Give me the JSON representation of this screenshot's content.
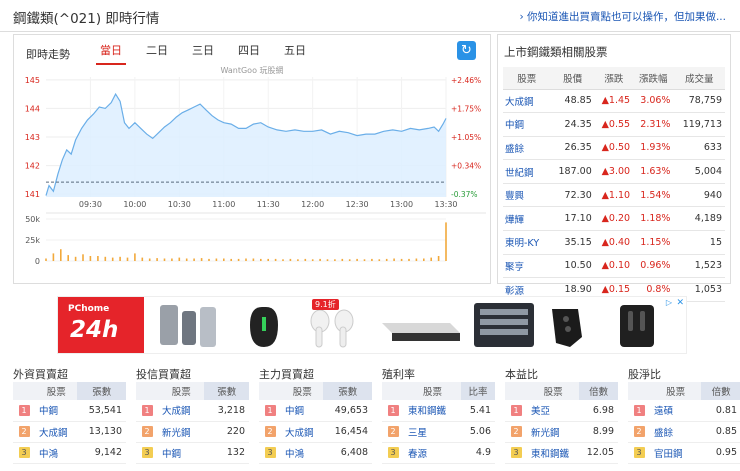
{
  "header": {
    "title": "鋼鐵類(^021) 即時行情",
    "hint_link": "› 你知道進出買賣點也可以操作，但加果做..."
  },
  "chart_panel": {
    "label": "即時走勢",
    "tabs": [
      "當日",
      "二日",
      "三日",
      "四日",
      "五日"
    ],
    "active_tab": 0,
    "watermark": "WantGoo 玩股網",
    "refresh_icon": "refresh-icon"
  },
  "chart_data": {
    "type": "area",
    "price_axis": {
      "ticks": [
        145,
        144,
        143,
        142,
        141
      ],
      "ylim": [
        140.9,
        145.1
      ],
      "pct_ticks": [
        "+2.46%",
        "+1.75%",
        "+1.05%",
        "+0.34%",
        "-0.37%"
      ],
      "reference": 141.42
    },
    "time_axis": {
      "ticks": [
        "09:30",
        "10:00",
        "10:30",
        "11:00",
        "11:30",
        "12:00",
        "12:30",
        "13:00",
        "13:30"
      ],
      "start": "09:00",
      "end": "13:30"
    },
    "price_series": [
      [
        "09:00",
        140.95
      ],
      [
        "09:02",
        141.3
      ],
      [
        "09:05",
        141.1
      ],
      [
        "09:08",
        141.7
      ],
      [
        "09:11",
        142.2
      ],
      [
        "09:14",
        142.55
      ],
      [
        "09:17",
        142.4
      ],
      [
        "09:20",
        142.9
      ],
      [
        "09:24",
        143.3
      ],
      [
        "09:28",
        143.6
      ],
      [
        "09:32",
        143.8
      ],
      [
        "09:36",
        144.05
      ],
      [
        "09:40",
        144.0
      ],
      [
        "09:44",
        144.2
      ],
      [
        "09:47",
        144.5
      ],
      [
        "09:50",
        144.25
      ],
      [
        "09:53",
        143.5
      ],
      [
        "09:56",
        143.3
      ],
      [
        "10:00",
        143.5
      ],
      [
        "10:04",
        143.3
      ],
      [
        "10:08",
        143.1
      ],
      [
        "10:12",
        142.95
      ],
      [
        "10:16",
        143.15
      ],
      [
        "10:20",
        143.35
      ],
      [
        "10:24",
        143.5
      ],
      [
        "10:28",
        143.7
      ],
      [
        "10:32",
        143.85
      ],
      [
        "10:36",
        143.95
      ],
      [
        "10:40",
        144.05
      ],
      [
        "10:44",
        144.15
      ],
      [
        "10:48",
        143.95
      ],
      [
        "10:52",
        143.75
      ],
      [
        "10:56",
        143.6
      ],
      [
        "11:00",
        143.5
      ],
      [
        "11:05",
        143.45
      ],
      [
        "11:10",
        143.3
      ],
      [
        "11:15",
        143.3
      ],
      [
        "11:20",
        143.45
      ],
      [
        "11:25",
        143.5
      ],
      [
        "11:30",
        143.35
      ],
      [
        "11:36",
        143.25
      ],
      [
        "11:42",
        143.2
      ],
      [
        "11:48",
        143.25
      ],
      [
        "11:54",
        143.2
      ],
      [
        "12:00",
        143.2
      ],
      [
        "12:06",
        143.25
      ],
      [
        "12:12",
        143.1
      ],
      [
        "12:18",
        143.2
      ],
      [
        "12:24",
        143.15
      ],
      [
        "12:30",
        143.05
      ],
      [
        "12:36",
        143.1
      ],
      [
        "12:42",
        143.1
      ],
      [
        "12:48",
        143.2
      ],
      [
        "12:54",
        143.25
      ],
      [
        "13:00",
        143.2
      ],
      [
        "13:06",
        143.3
      ],
      [
        "13:12",
        143.25
      ],
      [
        "13:18",
        143.3
      ],
      [
        "13:22",
        143.35
      ],
      [
        "13:25",
        143.2
      ],
      [
        "13:28",
        143.45
      ],
      [
        "13:30",
        143.65
      ]
    ],
    "volume_axis": {
      "ticks": [
        "50k",
        "25k",
        "0"
      ],
      "ylim": [
        0,
        50000
      ]
    },
    "volume_series": [
      [
        "09:00",
        3000
      ],
      [
        "09:05",
        9000
      ],
      [
        "09:10",
        14000
      ],
      [
        "09:15",
        7000
      ],
      [
        "09:20",
        5000
      ],
      [
        "09:25",
        8000
      ],
      [
        "09:30",
        6000
      ],
      [
        "09:35",
        6000
      ],
      [
        "09:40",
        5000
      ],
      [
        "09:45",
        4000
      ],
      [
        "09:50",
        5000
      ],
      [
        "09:55",
        4000
      ],
      [
        "10:00",
        9000
      ],
      [
        "10:05",
        4000
      ],
      [
        "10:10",
        3000
      ],
      [
        "10:15",
        3500
      ],
      [
        "10:20",
        3000
      ],
      [
        "10:25",
        3000
      ],
      [
        "10:30",
        4000
      ],
      [
        "10:35",
        3000
      ],
      [
        "10:40",
        3000
      ],
      [
        "10:45",
        3500
      ],
      [
        "10:50",
        2500
      ],
      [
        "10:55",
        3000
      ],
      [
        "11:00",
        3000
      ],
      [
        "11:05",
        2500
      ],
      [
        "11:10",
        2500
      ],
      [
        "11:15",
        3000
      ],
      [
        "11:20",
        3000
      ],
      [
        "11:25",
        2500
      ],
      [
        "11:30",
        2500
      ],
      [
        "11:35",
        2500
      ],
      [
        "11:40",
        2000
      ],
      [
        "11:45",
        2500
      ],
      [
        "11:50",
        2000
      ],
      [
        "11:55",
        2500
      ],
      [
        "12:00",
        2000
      ],
      [
        "12:05",
        2500
      ],
      [
        "12:10",
        2000
      ],
      [
        "12:15",
        2000
      ],
      [
        "12:20",
        2500
      ],
      [
        "12:25",
        2000
      ],
      [
        "12:30",
        2500
      ],
      [
        "12:35",
        2000
      ],
      [
        "12:40",
        2500
      ],
      [
        "12:45",
        2000
      ],
      [
        "12:50",
        2500
      ],
      [
        "12:55",
        3000
      ],
      [
        "13:00",
        2500
      ],
      [
        "13:05",
        2500
      ],
      [
        "13:10",
        3000
      ],
      [
        "13:15",
        3000
      ],
      [
        "13:20",
        4000
      ],
      [
        "13:25",
        6000
      ],
      [
        "13:30",
        46000
      ]
    ],
    "colors": {
      "line": "#6aaee8",
      "fill": "#ddeeff",
      "volume": "#f2a93b",
      "pct_up": "#d8261d",
      "pct_down": "#2a9d3a",
      "reference": "#5a6b7e"
    }
  },
  "related": {
    "title": "上市鋼鐵類相關股票",
    "columns": [
      "股票",
      "股價",
      "漲跌",
      "漲跌幅",
      "成交量"
    ],
    "rows": [
      [
        "大成鋼",
        "48.85",
        "▲1.45",
        "3.06%",
        "78,759"
      ],
      [
        "中鋼",
        "24.35",
        "▲0.55",
        "2.31%",
        "119,713"
      ],
      [
        "盛餘",
        "26.35",
        "▲0.50",
        "1.93%",
        "633"
      ],
      [
        "世紀鋼",
        "187.00",
        "▲3.00",
        "1.63%",
        "5,004"
      ],
      [
        "豐興",
        "72.30",
        "▲1.10",
        "1.54%",
        "940"
      ],
      [
        "燁輝",
        "17.10",
        "▲0.20",
        "1.18%",
        "4,189"
      ],
      [
        "東明-KY",
        "35.15",
        "▲0.40",
        "1.15%",
        "15"
      ],
      [
        "聚亨",
        "10.50",
        "▲0.10",
        "0.96%",
        "1,523"
      ],
      [
        "彰源",
        "18.90",
        "▲0.15",
        "0.8%",
        "1,053"
      ]
    ]
  },
  "ad": {
    "logo_top": "PChome",
    "logo_main": "24h",
    "badge": "9.1折",
    "adchoices": "▷",
    "close": "✕",
    "product_icons": [
      "usb-hub-icon",
      "gaming-mouse-icon",
      "earbuds-icon",
      "router-box-icon",
      "tool-kit-icon",
      "car-key-icon",
      "microphone-kit-icon"
    ]
  },
  "rankings": [
    {
      "title": "外資買賣超",
      "columns": [
        "股票",
        "張數"
      ],
      "rows": [
        [
          "1",
          "中鋼",
          "53,541"
        ],
        [
          "2",
          "大成鋼",
          "13,130"
        ],
        [
          "3",
          "中鴻",
          "9,142"
        ]
      ]
    },
    {
      "title": "投信買賣超",
      "columns": [
        "股票",
        "張數"
      ],
      "rows": [
        [
          "1",
          "大成鋼",
          "3,218"
        ],
        [
          "2",
          "新光鋼",
          "220"
        ],
        [
          "3",
          "中鋼",
          "132"
        ]
      ]
    },
    {
      "title": "主力買賣超",
      "columns": [
        "股票",
        "張數"
      ],
      "rows": [
        [
          "1",
          "中鋼",
          "49,653"
        ],
        [
          "2",
          "大成鋼",
          "16,454"
        ],
        [
          "3",
          "中鴻",
          "6,408"
        ]
      ]
    },
    {
      "title": "殖利率",
      "columns": [
        "股票",
        "比率"
      ],
      "rows": [
        [
          "1",
          "東和鋼鐵",
          "5.41"
        ],
        [
          "2",
          "三星",
          "5.06"
        ],
        [
          "3",
          "春源",
          "4.9"
        ]
      ]
    },
    {
      "title": "本益比",
      "columns": [
        "股票",
        "倍數"
      ],
      "rows": [
        [
          "1",
          "美亞",
          "6.98"
        ],
        [
          "2",
          "新光鋼",
          "8.99"
        ],
        [
          "3",
          "東和鋼鐵",
          "12.05"
        ]
      ]
    },
    {
      "title": "股淨比",
      "columns": [
        "股票",
        "倍數"
      ],
      "rows": [
        [
          "1",
          "遠碩",
          "0.81"
        ],
        [
          "2",
          "盛餘",
          "0.85"
        ],
        [
          "3",
          "官田鋼",
          "0.95"
        ]
      ]
    }
  ]
}
